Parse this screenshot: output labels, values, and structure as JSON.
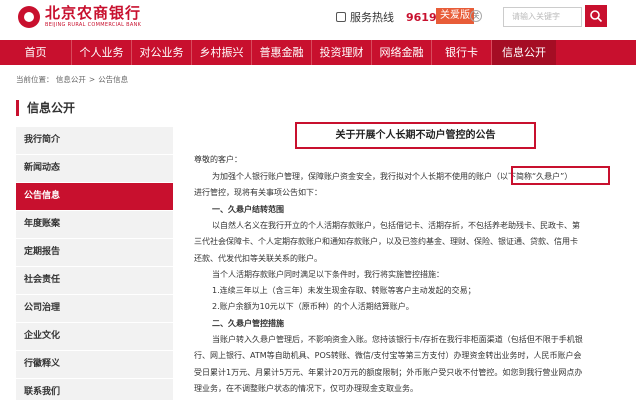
{
  "header": {
    "logo_cn": "北京农商银行",
    "logo_en": "BEIJING RURAL COMMERCIAL BANK",
    "hotline_label": "服务热线",
    "hotline_number": "96198",
    "care_version": "关爱版",
    "care_close": "关",
    "search_placeholder": "请输入关键字"
  },
  "nav": {
    "items": [
      "首页",
      "个人业务",
      "对公业务",
      "乡村振兴",
      "普惠金融",
      "投资理财",
      "网络金融",
      "银行卡",
      "信息公开"
    ],
    "active_index": 8
  },
  "breadcrumb": {
    "prefix": "当前位置：",
    "items": [
      "信息公开",
      "公告信息"
    ],
    "separator": ">"
  },
  "sidebar": {
    "title": "信息公开",
    "items": [
      "我行简介",
      "新闻动态",
      "公告信息",
      "年度账案",
      "定期报告",
      "社会责任",
      "公司治理",
      "企业文化",
      "行徽释义",
      "联系我们"
    ],
    "active_index": 2
  },
  "article": {
    "title": "关于开展个人长期不动户管控的公告",
    "greeting": "尊敬的客户：",
    "lines": [
      "为加强个人银行账户管理，保障账户资金安全，我行拟对个人长期不使用的账户（以下简称“久悬户”）",
      "进行管控，现将有关事项公告如下：",
      "一、久悬户结转范围",
      "以自然人名义在我行开立的个人活期存款账户，包括借记卡、活期存折，不包括养老助残卡、民政卡、第",
      "三代社会保障卡、个人定期存款账户和通知存款账户，以及已签约基金、理财、保险、银证通、贷款、信用卡",
      "还款、代发代扣等关联关系的账户。",
      "当个人活期存款账户同时满足以下条件时，我行将实施管控措施：",
      "1.连续三年以上（含三年）未发生现金存取、转账等客户主动发起的交易；",
      "2.账户余额为10元以下（原币种）的个人活期结算账户。",
      "二、久悬户管控措施",
      "当账户转入久悬户管理后，不影响资金入账。您持该银行卡/存折在我行非柜面渠道（包括但不限于手机银",
      "行、网上银行、ATM等自助机具、POS转账、微信/支付宝等第三方支付）办理资金转出业务时，人民币账户会",
      "受日累计1万元、月累计5万元、年累计20万元的额度限制；外币账户受只收不付管控。如您到我行营业网点办",
      "理业务，在不调整账户状态的情况下，仅可办理现金支取业务。"
    ]
  }
}
